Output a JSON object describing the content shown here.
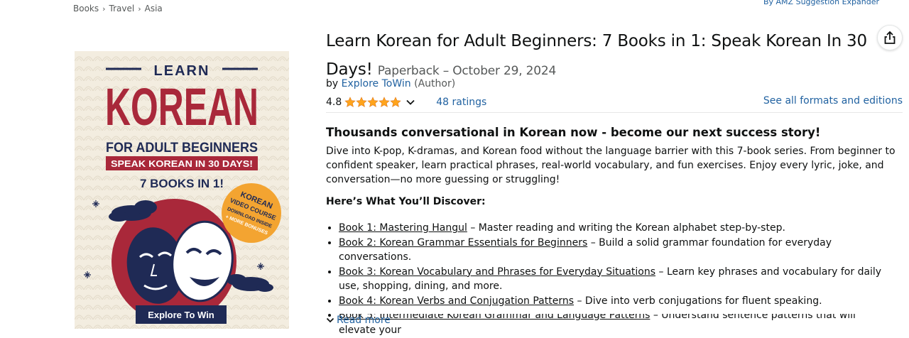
{
  "breadcrumb": [
    "Books",
    "Travel",
    "Asia"
  ],
  "top_link": "By AMZ Suggestion Expander",
  "cover": {
    "line1": "LEARN",
    "line2": "KOREAN",
    "line3": "FOR ADULT BEGINNERS",
    "line4": "SPEAK KOREAN IN 30 DAYS!",
    "line5": "7 BOOKS IN 1!",
    "badge": [
      "KOREAN",
      "VIDEO COURSE",
      "DOWNLOAD INSIDE",
      "+ MORE BONUSES"
    ],
    "publisher": "Explore To Win",
    "colors": {
      "bg": "#f3ede0",
      "red": "#a9283a",
      "navy": "#1f2a55",
      "orange": "#f3a431"
    }
  },
  "product": {
    "title": "Learn Korean for Adult Beginners: 7 Books in 1: Speak Korean In 30 Days!",
    "format": "Paperback – October 29, 2024",
    "by": "by",
    "author": "Explore ToWin",
    "role": "(Author)",
    "rating": "4.8",
    "stars": 5,
    "ratings_count": "48 ratings",
    "formats_link": "See all formats and editions"
  },
  "description": {
    "headline": "Thousands conversational in Korean now - become our next success story!",
    "paragraph": "Dive into K-pop, K-dramas, and Korean food without the language barrier with this 7-book series. From beginner to confident speaker, learn practical phrases, real-world vocabulary, and fun exercises. Enjoy every lyric, joke, and conversation—no more guessing or struggling!",
    "subhead": "Here’s What You’ll Discover:",
    "books": [
      {
        "link": "Book 1: Mastering Hangul",
        "text": " – Master reading and writing the Korean alphabet step-by-step."
      },
      {
        "link": "Book 2: Korean Grammar Essentials for Beginners",
        "text": " – Build a solid grammar foundation for everyday conversations."
      },
      {
        "link": "Book 3: Korean Vocabulary and Phrases for Everyday Situations",
        "text": " – Learn key phrases and vocabulary for daily use, shopping, dining, and more."
      },
      {
        "link": "Book 4: Korean Verbs and Conjugation Patterns",
        "text": " – Dive into verb conjugations for fluent speaking."
      },
      {
        "link": "Book 5: Intermediate Korean Grammar and Language Patterns",
        "text": " – Understand sentence patterns that will elevate your"
      }
    ],
    "read_more": "Read more"
  },
  "colors": {
    "link": "#2162a1",
    "star": "#ffa41c",
    "text": "#0f1111",
    "muted": "#565959"
  }
}
